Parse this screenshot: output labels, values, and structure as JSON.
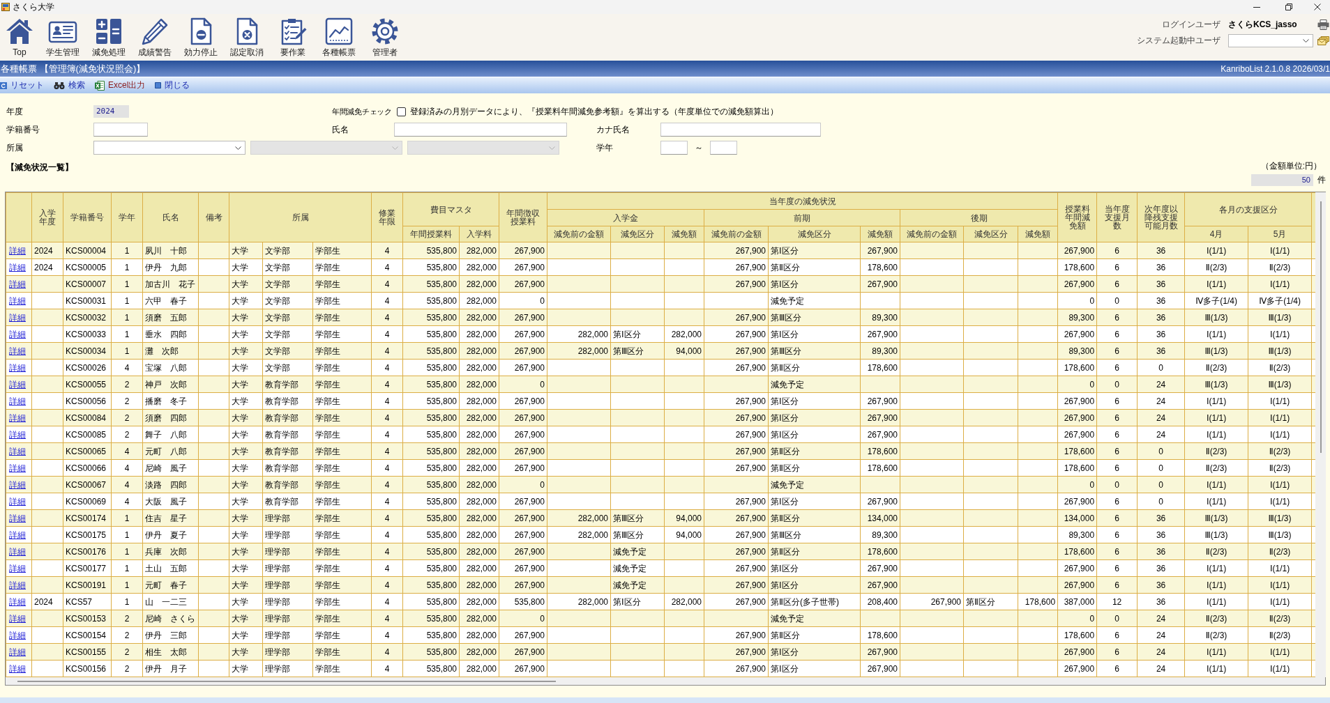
{
  "window": {
    "title": "さくら大学"
  },
  "toolbar": [
    {
      "label": "Top"
    },
    {
      "label": "学生管理"
    },
    {
      "label": "減免処理"
    },
    {
      "label": "成績警告"
    },
    {
      "label": "効力停止"
    },
    {
      "label": "認定取消"
    },
    {
      "label": "要作業"
    },
    {
      "label": "各種帳票"
    },
    {
      "label": "管理者"
    }
  ],
  "user_panel": {
    "login_label": "ログインユーザ",
    "login_user": "さくらKCS_jasso",
    "active_users_label": "システム起動中ユーザ"
  },
  "screen_bar": {
    "title": "各種帳票 【管理簿(減免状況照会)】",
    "version": "KanriboList 2.1.0.8 2026/03/1"
  },
  "actions": [
    {
      "label": "リセット"
    },
    {
      "label": "検索"
    },
    {
      "label": "Excel出力"
    },
    {
      "label": "閉じる"
    }
  ],
  "filters": {
    "year": {
      "label": "年度",
      "value": "2024"
    },
    "annual_check": {
      "label": "年間減免チェック",
      "checked": false,
      "text": "登録済みの月別データにより、『授業料年間減免参考額』を算出する（年度単位での減免額算出）"
    },
    "student_no": {
      "label": "学籍番号"
    },
    "name": {
      "label": "氏名"
    },
    "kana_name": {
      "label": "カナ氏名"
    },
    "affiliation": {
      "label": "所属",
      "selects": [
        {
          "disabled": false
        },
        {
          "disabled": true
        },
        {
          "disabled": true
        }
      ]
    },
    "grade": {
      "label": "学年",
      "separator": "～"
    }
  },
  "list": {
    "title": "【減免状況一覧】",
    "unit": "（金額単位:円）",
    "count": "50",
    "count_unit": "件"
  },
  "table": {
    "header": {
      "leading": [
        "入学年度",
        "学籍番号",
        "学年",
        "氏名",
        "備考"
      ],
      "affiliation": "所属",
      "years": "修業年限",
      "fee_master": {
        "label": "費目マスタ",
        "columns": [
          "年間授業料",
          "入学料"
        ]
      },
      "collected": "年間徴収授業料",
      "reduction": {
        "label": "当年度の減免状況",
        "terms": [
          {
            "label": "入学金",
            "columns": [
              "減免前の金額",
              "減免区分",
              "減免額"
            ]
          },
          {
            "label": "前期",
            "columns": [
              "減免前の金額",
              "減免区分",
              "減免額"
            ]
          },
          {
            "label": "後期",
            "columns": [
              "減免前の金額",
              "減免区分",
              "減免額"
            ]
          }
        ]
      },
      "trailing": [
        "授業料年間減免額",
        "当年度支援月数",
        "次年度以降残支援可能月数"
      ],
      "monthly": {
        "label": "各月の支援区分",
        "columns": [
          "4月",
          "5月"
        ]
      }
    },
    "rows": [
      {
        "link": "詳細",
        "entry_year": "2024",
        "student_no": "KCS00004",
        "grade": "1",
        "name": "夙川　十郎",
        "affiliation": [
          "大学",
          "文学部",
          "学部生"
        ],
        "years": "4",
        "fees": [
          "535,800",
          "282,000"
        ],
        "collected": "267,900",
        "first_half": {
          "before": "267,900",
          "category": "第Ⅰ区分",
          "amount": "267,900"
        },
        "annual_reduction": "267,900",
        "months": "6",
        "remaining_months": "36",
        "monthly": [
          "Ⅰ(1/1)",
          "Ⅰ(1/1)"
        ]
      },
      {
        "link": "詳細",
        "entry_year": "2024",
        "student_no": "KCS00005",
        "grade": "1",
        "name": "伊丹　九郎",
        "affiliation": [
          "大学",
          "文学部",
          "学部生"
        ],
        "years": "4",
        "fees": [
          "535,800",
          "282,000"
        ],
        "collected": "267,900",
        "first_half": {
          "before": "267,900",
          "category": "第Ⅱ区分",
          "amount": "178,600"
        },
        "annual_reduction": "178,600",
        "months": "6",
        "remaining_months": "36",
        "monthly": [
          "Ⅱ(2/3)",
          "Ⅱ(2/3)"
        ]
      },
      {
        "link": "詳細",
        "student_no": "KCS00007",
        "grade": "1",
        "name": "加古川　花子",
        "affiliation": [
          "大学",
          "文学部",
          "学部生"
        ],
        "years": "4",
        "fees": [
          "535,800",
          "282,000"
        ],
        "collected": "267,900",
        "first_half": {
          "before": "267,900",
          "category": "第Ⅰ区分",
          "amount": "267,900"
        },
        "annual_reduction": "267,900",
        "months": "6",
        "remaining_months": "36",
        "monthly": [
          "Ⅰ(1/1)",
          "Ⅰ(1/1)"
        ]
      },
      {
        "link": "詳細",
        "student_no": "KCS00031",
        "grade": "1",
        "name": "六甲　春子",
        "affiliation": [
          "大学",
          "文学部",
          "学部生"
        ],
        "years": "4",
        "fees": [
          "535,800",
          "282,000"
        ],
        "collected": "0",
        "first_half": {
          "category": "減免予定"
        },
        "annual_reduction": "0",
        "months": "0",
        "remaining_months": "36",
        "monthly": [
          "Ⅳ多子(1/4)",
          "Ⅳ多子(1/4)"
        ]
      },
      {
        "link": "詳細",
        "student_no": "KCS00032",
        "grade": "1",
        "name": "須磨　五郎",
        "affiliation": [
          "大学",
          "文学部",
          "学部生"
        ],
        "years": "4",
        "fees": [
          "535,800",
          "282,000"
        ],
        "collected": "267,900",
        "first_half": {
          "before": "267,900",
          "category": "第Ⅲ区分",
          "amount": "89,300"
        },
        "annual_reduction": "89,300",
        "months": "6",
        "remaining_months": "36",
        "monthly": [
          "Ⅲ(1/3)",
          "Ⅲ(1/3)"
        ]
      },
      {
        "link": "詳細",
        "student_no": "KCS00033",
        "grade": "1",
        "name": "垂水　四郎",
        "affiliation": [
          "大学",
          "文学部",
          "学部生"
        ],
        "years": "4",
        "fees": [
          "535,800",
          "282,000"
        ],
        "collected": "267,900",
        "admission": {
          "before": "282,000",
          "category": "第Ⅰ区分",
          "amount": "282,000"
        },
        "first_half": {
          "before": "267,900",
          "category": "第Ⅰ区分",
          "amount": "267,900"
        },
        "annual_reduction": "267,900",
        "months": "6",
        "remaining_months": "36",
        "monthly": [
          "Ⅰ(1/1)",
          "Ⅰ(1/1)"
        ]
      },
      {
        "link": "詳細",
        "student_no": "KCS00034",
        "grade": "1",
        "name": "灘　次郎",
        "affiliation": [
          "大学",
          "文学部",
          "学部生"
        ],
        "years": "4",
        "fees": [
          "535,800",
          "282,000"
        ],
        "collected": "267,900",
        "admission": {
          "before": "282,000",
          "category": "第Ⅲ区分",
          "amount": "94,000"
        },
        "first_half": {
          "before": "267,900",
          "category": "第Ⅲ区分",
          "amount": "89,300"
        },
        "annual_reduction": "89,300",
        "months": "6",
        "remaining_months": "36",
        "monthly": [
          "Ⅲ(1/3)",
          "Ⅲ(1/3)"
        ]
      },
      {
        "link": "詳細",
        "student_no": "KCS00026",
        "grade": "4",
        "name": "宝塚　八郎",
        "affiliation": [
          "大学",
          "文学部",
          "学部生"
        ],
        "years": "4",
        "fees": [
          "535,800",
          "282,000"
        ],
        "collected": "267,900",
        "first_half": {
          "before": "267,900",
          "category": "第Ⅱ区分",
          "amount": "178,600"
        },
        "annual_reduction": "178,600",
        "months": "6",
        "remaining_months": "0",
        "monthly": [
          "Ⅱ(2/3)",
          "Ⅱ(2/3)"
        ]
      },
      {
        "link": "詳細",
        "student_no": "KCS00055",
        "grade": "2",
        "name": "神戸　次郎",
        "affiliation": [
          "大学",
          "教育学部",
          "学部生"
        ],
        "years": "4",
        "fees": [
          "535,800",
          "282,000"
        ],
        "collected": "0",
        "first_half": {
          "category": "減免予定"
        },
        "annual_reduction": "0",
        "months": "0",
        "remaining_months": "24",
        "monthly": [
          "Ⅲ(1/3)",
          "Ⅲ(1/3)"
        ]
      },
      {
        "link": "詳細",
        "student_no": "KCS00056",
        "grade": "2",
        "name": "播磨　冬子",
        "affiliation": [
          "大学",
          "教育学部",
          "学部生"
        ],
        "years": "4",
        "fees": [
          "535,800",
          "282,000"
        ],
        "collected": "267,900",
        "first_half": {
          "before": "267,900",
          "category": "第Ⅰ区分",
          "amount": "267,900"
        },
        "annual_reduction": "267,900",
        "months": "6",
        "remaining_months": "24",
        "monthly": [
          "Ⅰ(1/1)",
          "Ⅰ(1/1)"
        ]
      },
      {
        "link": "詳細",
        "student_no": "KCS00084",
        "grade": "2",
        "name": "須磨　四郎",
        "affiliation": [
          "大学",
          "教育学部",
          "学部生"
        ],
        "years": "4",
        "fees": [
          "535,800",
          "282,000"
        ],
        "collected": "267,900",
        "first_half": {
          "before": "267,900",
          "category": "第Ⅰ区分",
          "amount": "267,900"
        },
        "annual_reduction": "267,900",
        "months": "6",
        "remaining_months": "24",
        "monthly": [
          "Ⅰ(1/1)",
          "Ⅰ(1/1)"
        ]
      },
      {
        "link": "詳細",
        "student_no": "KCS00085",
        "grade": "2",
        "name": "舞子　八郎",
        "affiliation": [
          "大学",
          "教育学部",
          "学部生"
        ],
        "years": "4",
        "fees": [
          "535,800",
          "282,000"
        ],
        "collected": "267,900",
        "first_half": {
          "before": "267,900",
          "category": "第Ⅰ区分",
          "amount": "267,900"
        },
        "annual_reduction": "267,900",
        "months": "6",
        "remaining_months": "24",
        "monthly": [
          "Ⅰ(1/1)",
          "Ⅰ(1/1)"
        ]
      },
      {
        "link": "詳細",
        "student_no": "KCS00065",
        "grade": "4",
        "name": "元町　八郎",
        "affiliation": [
          "大学",
          "教育学部",
          "学部生"
        ],
        "years": "4",
        "fees": [
          "535,800",
          "282,000"
        ],
        "collected": "267,900",
        "first_half": {
          "before": "267,900",
          "category": "第Ⅱ区分",
          "amount": "178,600"
        },
        "annual_reduction": "178,600",
        "months": "6",
        "remaining_months": "0",
        "monthly": [
          "Ⅱ(2/3)",
          "Ⅱ(2/3)"
        ]
      },
      {
        "link": "詳細",
        "student_no": "KCS00066",
        "grade": "4",
        "name": "尼崎　風子",
        "affiliation": [
          "大学",
          "教育学部",
          "学部生"
        ],
        "years": "4",
        "fees": [
          "535,800",
          "282,000"
        ],
        "collected": "267,900",
        "first_half": {
          "before": "267,900",
          "category": "第Ⅱ区分",
          "amount": "178,600"
        },
        "annual_reduction": "178,600",
        "months": "6",
        "remaining_months": "0",
        "monthly": [
          "Ⅱ(2/3)",
          "Ⅱ(2/3)"
        ]
      },
      {
        "link": "詳細",
        "student_no": "KCS00067",
        "grade": "4",
        "name": "淡路　四郎",
        "affiliation": [
          "大学",
          "教育学部",
          "学部生"
        ],
        "years": "4",
        "fees": [
          "535,800",
          "282,000"
        ],
        "collected": "0",
        "first_half": {
          "category": "減免予定"
        },
        "annual_reduction": "0",
        "months": "0",
        "remaining_months": "0",
        "monthly": [
          "Ⅰ(1/1)",
          "Ⅰ(1/1)"
        ]
      },
      {
        "link": "詳細",
        "student_no": "KCS00069",
        "grade": "4",
        "name": "大阪　風子",
        "affiliation": [
          "大学",
          "教育学部",
          "学部生"
        ],
        "years": "4",
        "fees": [
          "535,800",
          "282,000"
        ],
        "collected": "267,900",
        "first_half": {
          "before": "267,900",
          "category": "第Ⅰ区分",
          "amount": "267,900"
        },
        "annual_reduction": "267,900",
        "months": "6",
        "remaining_months": "0",
        "monthly": [
          "Ⅰ(1/1)",
          "Ⅰ(1/1)"
        ]
      },
      {
        "link": "詳細",
        "student_no": "KCS00174",
        "grade": "1",
        "name": "住吉　星子",
        "affiliation": [
          "大学",
          "理学部",
          "学部生"
        ],
        "years": "4",
        "fees": [
          "535,800",
          "282,000"
        ],
        "collected": "267,900",
        "admission": {
          "before": "282,000",
          "category": "第Ⅲ区分",
          "amount": "94,000"
        },
        "first_half": {
          "before": "267,900",
          "category": "第Ⅱ区分",
          "amount": "134,000"
        },
        "annual_reduction": "134,000",
        "months": "6",
        "remaining_months": "36",
        "monthly": [
          "Ⅲ(1/3)",
          "Ⅲ(1/3)"
        ]
      },
      {
        "link": "詳細",
        "student_no": "KCS00175",
        "grade": "1",
        "name": "伊丹　夏子",
        "affiliation": [
          "大学",
          "理学部",
          "学部生"
        ],
        "years": "4",
        "fees": [
          "535,800",
          "282,000"
        ],
        "collected": "267,900",
        "admission": {
          "before": "282,000",
          "category": "第Ⅲ区分",
          "amount": "94,000"
        },
        "first_half": {
          "before": "267,900",
          "category": "第Ⅲ区分",
          "amount": "89,300"
        },
        "annual_reduction": "89,300",
        "months": "6",
        "remaining_months": "36",
        "monthly": [
          "Ⅲ(1/3)",
          "Ⅲ(1/3)"
        ]
      },
      {
        "link": "詳細",
        "student_no": "KCS00176",
        "grade": "1",
        "name": "兵庫　次郎",
        "affiliation": [
          "大学",
          "理学部",
          "学部生"
        ],
        "years": "4",
        "fees": [
          "535,800",
          "282,000"
        ],
        "collected": "267,900",
        "admission": {
          "category": "減免予定"
        },
        "first_half": {
          "before": "267,900",
          "category": "第Ⅱ区分",
          "amount": "178,600"
        },
        "annual_reduction": "178,600",
        "months": "6",
        "remaining_months": "36",
        "monthly": [
          "Ⅱ(2/3)",
          "Ⅱ(2/3)"
        ]
      },
      {
        "link": "詳細",
        "student_no": "KCS00177",
        "grade": "1",
        "name": "土山　五郎",
        "affiliation": [
          "大学",
          "理学部",
          "学部生"
        ],
        "years": "4",
        "fees": [
          "535,800",
          "282,000"
        ],
        "collected": "267,900",
        "admission": {
          "category": "減免予定"
        },
        "first_half": {
          "before": "267,900",
          "category": "第Ⅰ区分",
          "amount": "267,900"
        },
        "annual_reduction": "267,900",
        "months": "6",
        "remaining_months": "36",
        "monthly": [
          "Ⅰ(1/1)",
          "Ⅰ(1/1)"
        ]
      },
      {
        "link": "詳細",
        "student_no": "KCS00191",
        "grade": "1",
        "name": "元町　春子",
        "affiliation": [
          "大学",
          "理学部",
          "学部生"
        ],
        "years": "4",
        "fees": [
          "535,800",
          "282,000"
        ],
        "collected": "267,900",
        "admission": {
          "category": "減免予定"
        },
        "first_half": {
          "before": "267,900",
          "category": "第Ⅰ区分",
          "amount": "267,900"
        },
        "annual_reduction": "267,900",
        "months": "6",
        "remaining_months": "36",
        "monthly": [
          "Ⅰ(1/1)",
          "Ⅰ(1/1)"
        ]
      },
      {
        "link": "詳細",
        "entry_year": "2024",
        "student_no": "KCS57",
        "grade": "1",
        "name": "山　一二三",
        "affiliation": [
          "大学",
          "理学部",
          "学部生"
        ],
        "years": "4",
        "fees": [
          "535,800",
          "282,000"
        ],
        "collected": "535,800",
        "admission": {
          "before": "282,000",
          "category": "第Ⅰ区分",
          "amount": "282,000"
        },
        "first_half": {
          "before": "267,900",
          "category": "第Ⅱ区分(多子世帯)",
          "amount": "208,400"
        },
        "second_half": {
          "before": "267,900",
          "category": "第Ⅱ区分",
          "amount": "178,600"
        },
        "annual_reduction": "387,000",
        "months": "12",
        "remaining_months": "36",
        "monthly": [
          "Ⅰ(1/1)",
          "Ⅰ(1/1)"
        ]
      },
      {
        "link": "詳細",
        "student_no": "KCS00153",
        "grade": "2",
        "name": "尼崎　さくら",
        "affiliation": [
          "大学",
          "理学部",
          "学部生"
        ],
        "years": "4",
        "fees": [
          "535,800",
          "282,000"
        ],
        "collected": "0",
        "first_half": {
          "category": "減免予定"
        },
        "annual_reduction": "0",
        "months": "0",
        "remaining_months": "24",
        "monthly": [
          "Ⅱ(2/3)",
          "Ⅱ(2/3)"
        ]
      },
      {
        "link": "詳細",
        "student_no": "KCS00154",
        "grade": "2",
        "name": "伊丹　三郎",
        "affiliation": [
          "大学",
          "理学部",
          "学部生"
        ],
        "years": "4",
        "fees": [
          "535,800",
          "282,000"
        ],
        "collected": "267,900",
        "first_half": {
          "before": "267,900",
          "category": "第Ⅱ区分",
          "amount": "178,600"
        },
        "annual_reduction": "178,600",
        "months": "6",
        "remaining_months": "24",
        "monthly": [
          "Ⅱ(2/3)",
          "Ⅱ(2/3)"
        ]
      },
      {
        "link": "詳細",
        "student_no": "KCS00155",
        "grade": "2",
        "name": "相生　太郎",
        "affiliation": [
          "大学",
          "理学部",
          "学部生"
        ],
        "years": "4",
        "fees": [
          "535,800",
          "282,000"
        ],
        "collected": "267,900",
        "first_half": {
          "before": "267,900",
          "category": "第Ⅰ区分",
          "amount": "267,900"
        },
        "annual_reduction": "267,900",
        "months": "6",
        "remaining_months": "24",
        "monthly": [
          "Ⅰ(1/1)",
          "Ⅰ(1/1)"
        ]
      },
      {
        "link": "詳細",
        "student_no": "KCS00156",
        "grade": "2",
        "name": "伊丹　月子",
        "affiliation": [
          "大学",
          "理学部",
          "学部生"
        ],
        "years": "4",
        "fees": [
          "535,800",
          "282,000"
        ],
        "collected": "267,900",
        "first_half": {
          "before": "267,900",
          "category": "第Ⅰ区分",
          "amount": "267,900"
        },
        "annual_reduction": "267,900",
        "months": "6",
        "remaining_months": "24",
        "monthly": [
          "Ⅰ(1/1)",
          "Ⅰ(1/1)"
        ]
      }
    ]
  }
}
